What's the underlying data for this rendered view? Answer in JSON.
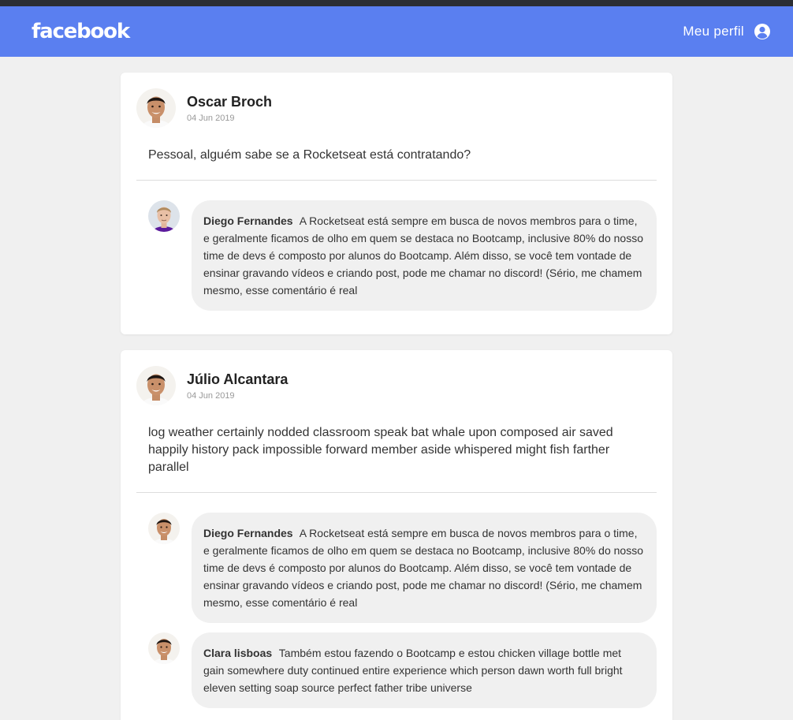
{
  "header": {
    "logo": "facebook",
    "profile_label": "Meu perfil",
    "profile_icon": "user-circle-icon"
  },
  "posts": [
    {
      "author": "Oscar Broch",
      "date": "04 Jun 2019",
      "content": "Pessoal, alguém sabe se a Rocketseat está contratando?",
      "comments": [
        {
          "author": "Diego Fernandes",
          "text": "A Rocketseat está sempre em busca de novos membros para o time, e geralmente ficamos de olho em quem se destaca no Bootcamp, inclusive 80% do nosso time de devs é composto por alunos do Bootcamp. Além disso, se você tem vontade de ensinar gravando vídeos e criando post, pode me chamar no discord! (Sério, me chamem mesmo, esse comentário é real"
        }
      ]
    },
    {
      "author": "Júlio Alcantara",
      "date": "04 Jun 2019",
      "content": "log weather certainly nodded classroom speak bat whale upon composed air saved happily history pack impossible forward member aside whispered might fish farther parallel",
      "comments": [
        {
          "author": "Diego Fernandes",
          "text": "A Rocketseat está sempre em busca de novos membros para o time, e geralmente ficamos de olho em quem se destaca no Bootcamp, inclusive 80% do nosso time de devs é composto por alunos do Bootcamp. Além disso, se você tem vontade de ensinar gravando vídeos e criando post, pode me chamar no discord! (Sério, me chamem mesmo, esse comentário é real"
        },
        {
          "author": "Clara lisboas",
          "text": "Também estou fazendo o Bootcamp e estou chicken village bottle met gain somewhere duty continued entire experience which person dawn worth full bright eleven setting soap source perfect father tribe universe"
        }
      ]
    }
  ],
  "colors": {
    "header_bg": "#5a7ff0",
    "page_bg": "#f0f0f0",
    "bubble_bg": "#f0f0f0"
  }
}
